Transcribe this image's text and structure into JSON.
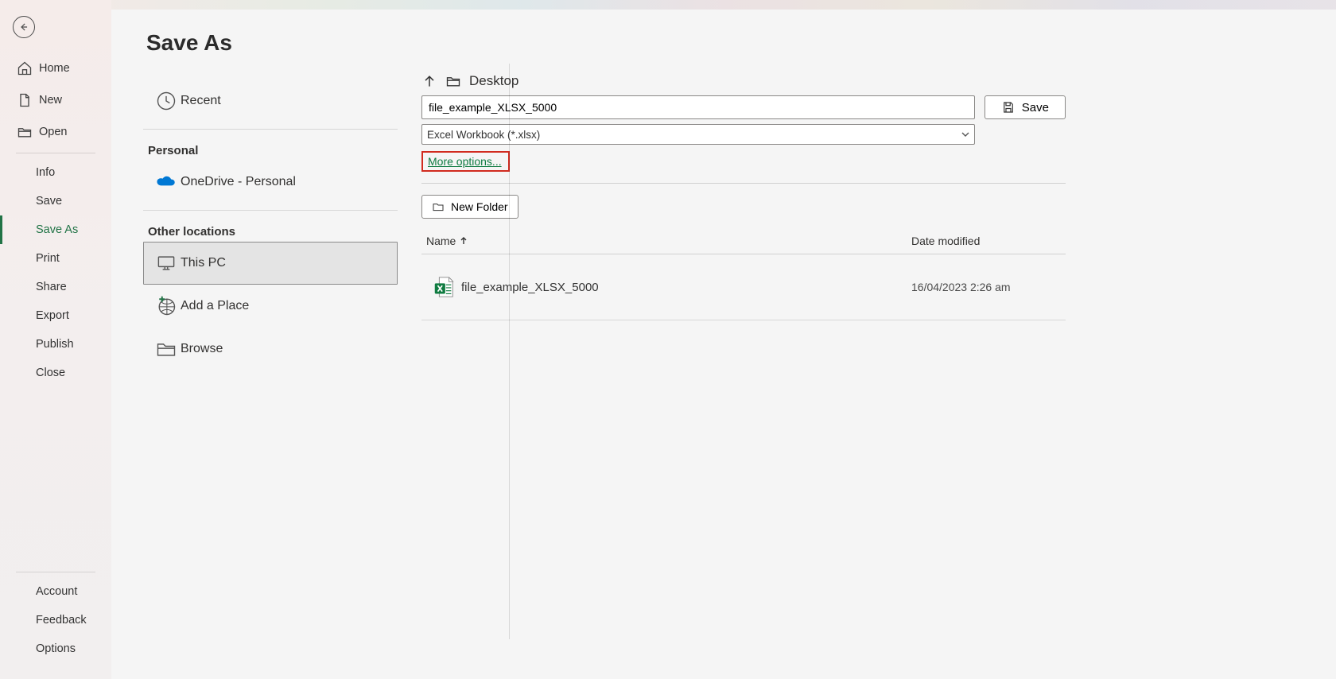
{
  "sidebar": {
    "home": "Home",
    "new": "New",
    "open": "Open",
    "info": "Info",
    "save": "Save",
    "save_as": "Save As",
    "print": "Print",
    "share": "Share",
    "export": "Export",
    "publish": "Publish",
    "close": "Close",
    "account": "Account",
    "feedback": "Feedback",
    "options": "Options"
  },
  "page": {
    "title": "Save As"
  },
  "locations": {
    "recent": "Recent",
    "section_personal": "Personal",
    "onedrive_personal": "OneDrive - Personal",
    "section_other": "Other locations",
    "this_pc": "This PC",
    "add_place": "Add a Place",
    "browse": "Browse"
  },
  "details": {
    "breadcrumb": "Desktop",
    "filename": "file_example_XLSX_5000",
    "file_type": "Excel Workbook (*.xlsx)",
    "more_options": "More options...",
    "save_btn": "Save",
    "new_folder": "New Folder",
    "col_name": "Name",
    "col_date": "Date modified",
    "files": [
      {
        "name": "file_example_XLSX_5000",
        "date": "16/04/2023 2:26 am"
      }
    ]
  }
}
